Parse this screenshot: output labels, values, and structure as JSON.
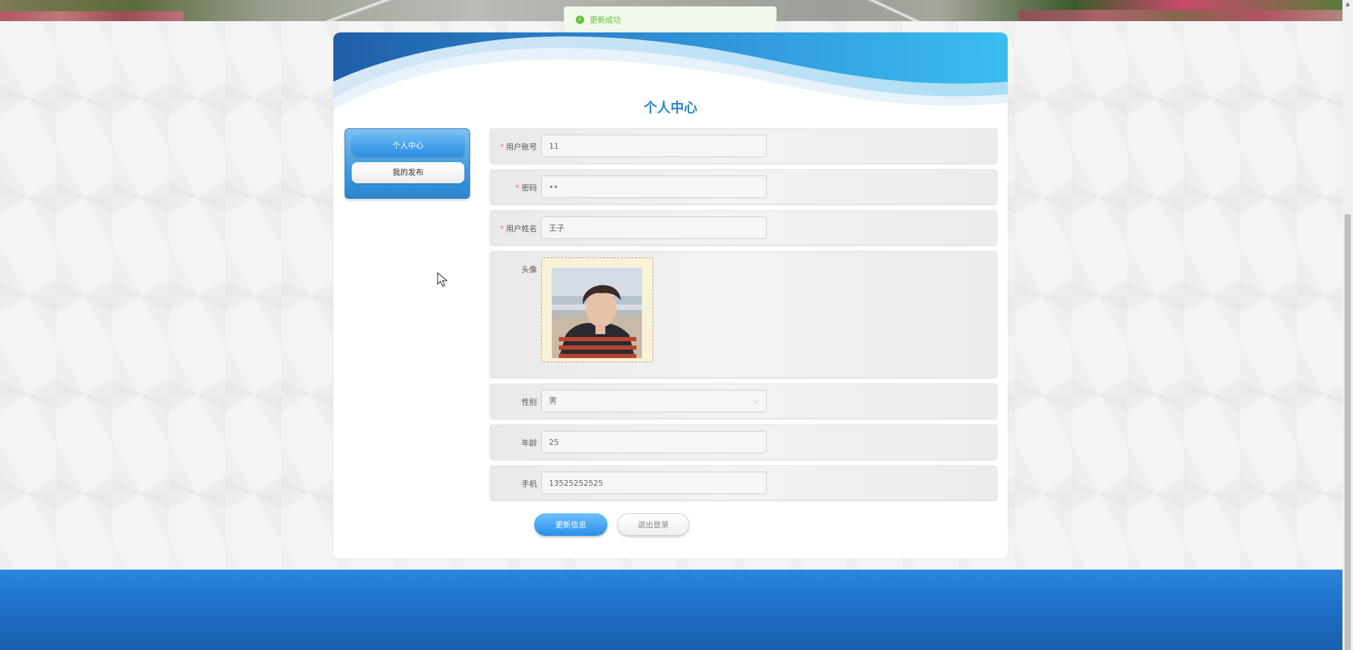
{
  "toast": {
    "message": "更新成功",
    "icon": "success-check-icon",
    "color": "#67c23a"
  },
  "page": {
    "title": "个人中心"
  },
  "side_menu": {
    "items": [
      {
        "label": "个人中心",
        "active": true
      },
      {
        "label": "我的发布",
        "active": false
      }
    ]
  },
  "form": {
    "account": {
      "label": "用户账号",
      "required": true,
      "value": "11"
    },
    "password": {
      "label": "密码",
      "required": true,
      "value": "••"
    },
    "name": {
      "label": "用户姓名",
      "required": true,
      "value": "王子"
    },
    "avatar": {
      "label": "头像"
    },
    "gender": {
      "label": "性别",
      "value": "男"
    },
    "age": {
      "label": "年龄",
      "value": "25"
    },
    "phone": {
      "label": "手机",
      "value": "13525252525"
    }
  },
  "actions": {
    "update_label": "更新信息",
    "logout_label": "退出登录"
  },
  "colors": {
    "primary": "#2a8ee6",
    "title": "#2a86c7",
    "footer": "#1d6fc7"
  }
}
